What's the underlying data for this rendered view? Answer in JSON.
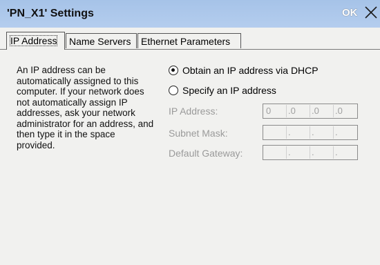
{
  "window": {
    "title": "'PN_X1' Settings",
    "ok_label": "OK"
  },
  "tabs": [
    {
      "label": "IP Address",
      "active": true
    },
    {
      "label": "Name Servers",
      "active": false
    },
    {
      "label": "Ethernet Parameters",
      "active": false
    }
  ],
  "description": "An IP address can be automatically assigned to this computer.  If your network does not automatically assign IP addresses, ask your network administrator for an address, and then type it in the space provided.",
  "options": {
    "dhcp_label": "Obtain an IP address via DHCP",
    "dhcp_selected": true,
    "static_label": "Specify an IP address",
    "static_selected": false
  },
  "fields": {
    "ip_label": "IP Address:",
    "ip_octets": [
      "0",
      ".0",
      ".0",
      ".0"
    ],
    "subnet_label": "Subnet Mask:",
    "subnet_octets": [
      "",
      ".",
      ".",
      "."
    ],
    "gateway_label": "Default Gateway:",
    "gateway_octets": [
      "",
      ".",
      ".",
      "."
    ]
  },
  "colors": {
    "titlebar": "#a6c3e8",
    "background": "#f1f1ef",
    "disabled_text": "#9a9a9a"
  }
}
